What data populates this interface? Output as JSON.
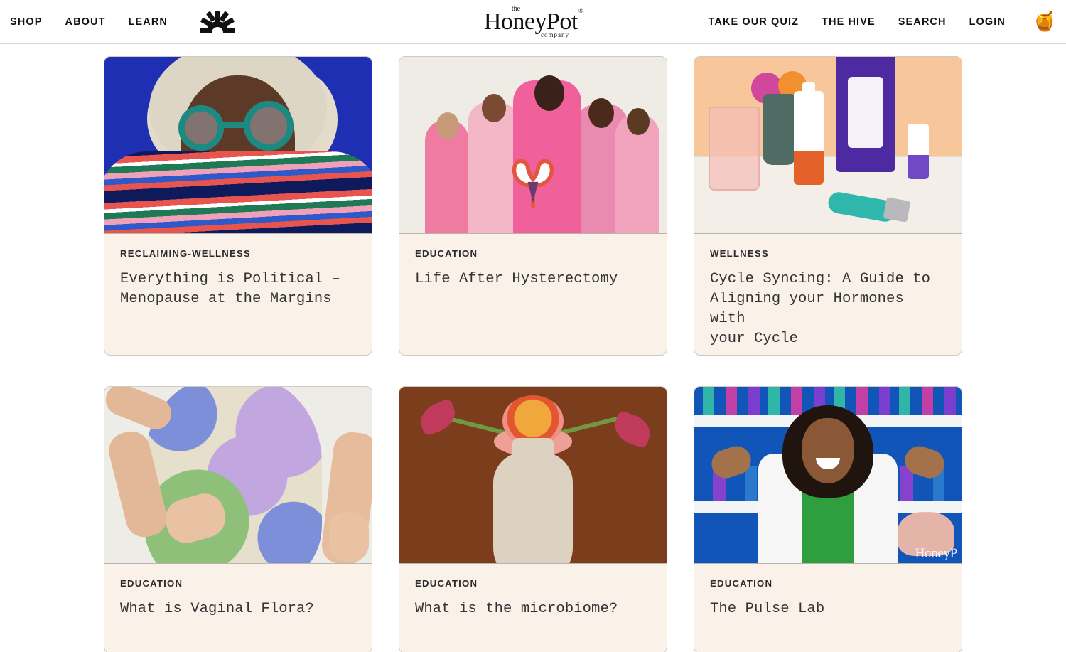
{
  "header": {
    "nav_left": [
      {
        "label": "SHOP",
        "name": "nav-shop"
      },
      {
        "label": "ABOUT",
        "name": "nav-about"
      },
      {
        "label": "LEARN",
        "name": "nav-learn"
      }
    ],
    "brand_icon": "sunburst-icon",
    "logo": {
      "the": "the",
      "main": "HoneyPot",
      "registered": "®",
      "company": "company"
    },
    "nav_right": [
      {
        "label": "TAKE OUR QUIZ",
        "name": "nav-take-our-quiz"
      },
      {
        "label": "THE HIVE",
        "name": "nav-the-hive"
      },
      {
        "label": "SEARCH",
        "name": "nav-search"
      },
      {
        "label": "LOGIN",
        "name": "nav-login"
      }
    ],
    "cart_icon": "honey-pot-cart-icon",
    "cart_glyph": "🍯"
  },
  "colors": {
    "card_background": "#faf1e9",
    "card_border": "#cfcac4",
    "page_background": "#ffffff",
    "text": "#333333",
    "category_text": "#2b2b2b"
  },
  "cards": [
    {
      "category": "RECLAIMING-WELLNESS",
      "title": "Everything is Political –\nMenopause at the Margins",
      "image_alt": "portrait-woman-glasses-blue-background"
    },
    {
      "category": "EDUCATION",
      "title": "Life After Hysterectomy",
      "image_alt": "five-women-pink-suits-uterus-prop"
    },
    {
      "category": "WELLNESS",
      "title": "Cycle Syncing: A Guide to\nAligning your Hormones with\nyour Cycle",
      "image_alt": "honeypot-products-peach-background"
    },
    {
      "category": "EDUCATION",
      "title": "What is Vaginal Flora?",
      "image_alt": "torso-wavy-pattern-dress"
    },
    {
      "category": "EDUCATION",
      "title": "What is the microbiome?",
      "image_alt": "flowers-in-vase-brown-background"
    },
    {
      "category": "EDUCATION",
      "title": "The Pulse Lab",
      "image_alt": "scientist-lab-coat-blue-lab",
      "watermark": "HoneyP"
    }
  ]
}
